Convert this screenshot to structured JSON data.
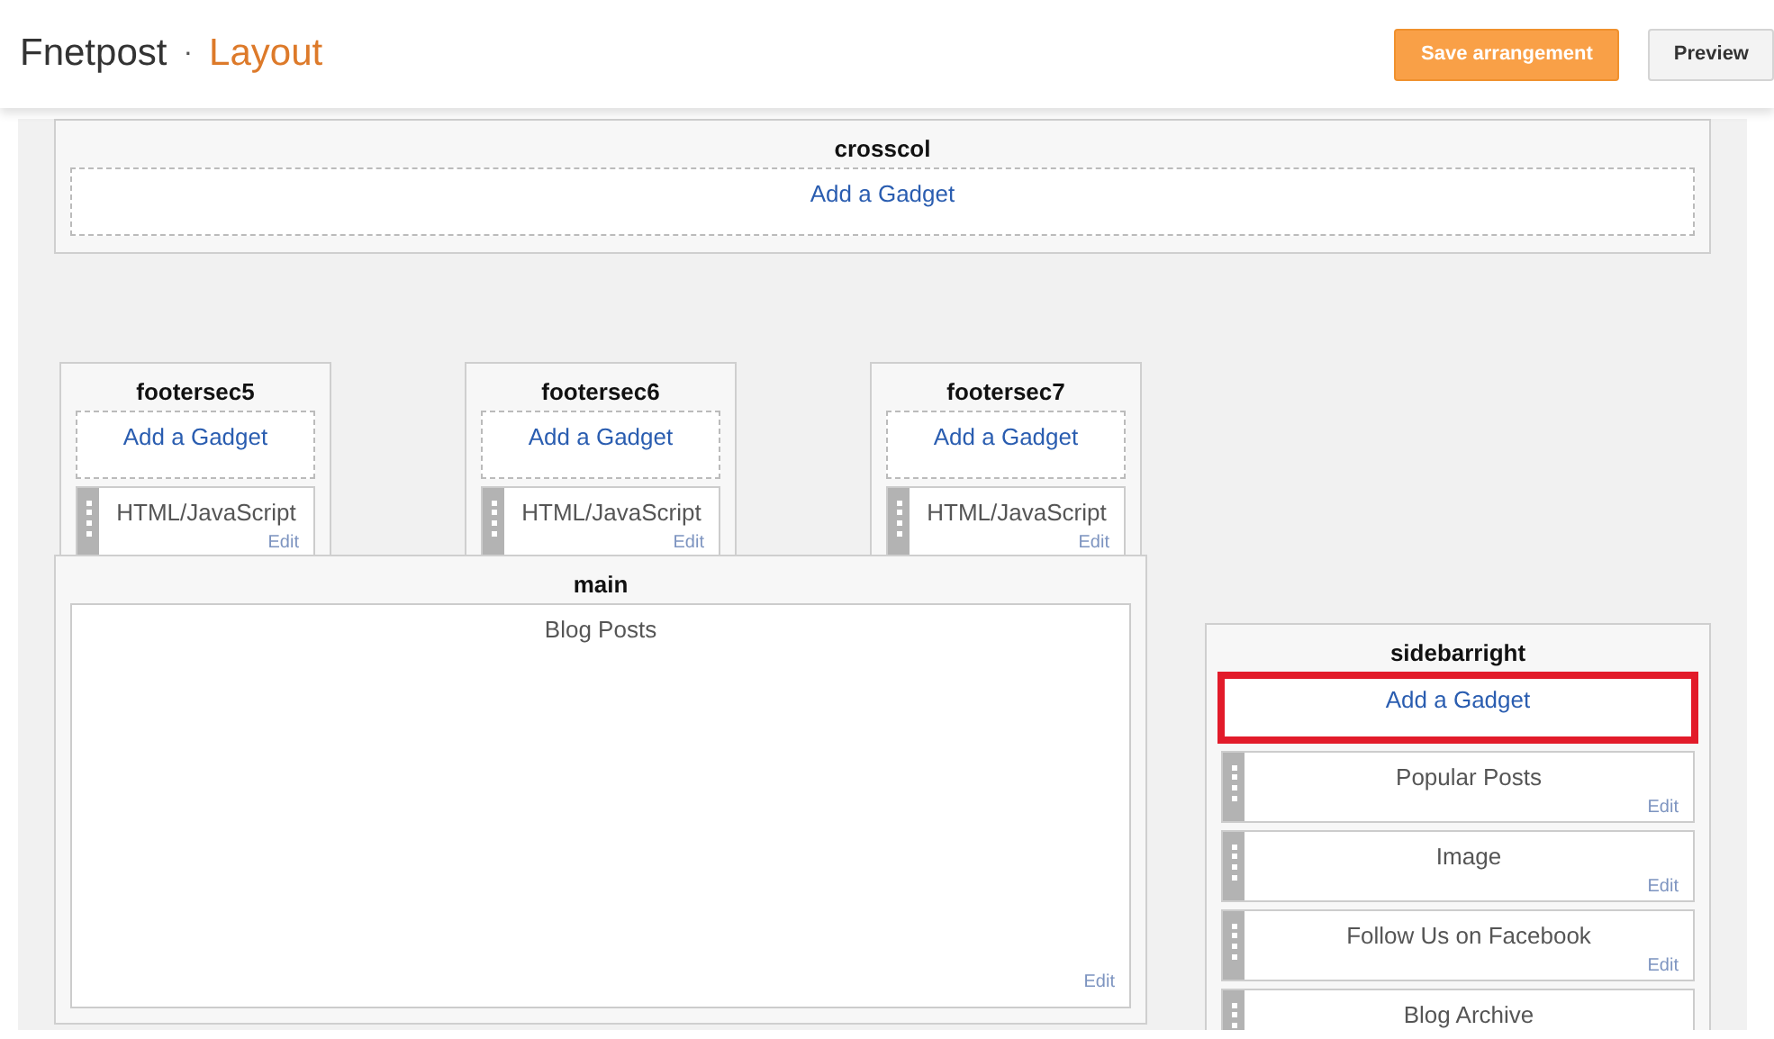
{
  "header": {
    "blog_name": "Fnetpost",
    "separator": "·",
    "page_title": "Layout",
    "buttons": [
      {
        "kind": "primary",
        "label": "Save arrangement"
      },
      {
        "kind": "secondary",
        "label": "Preview"
      }
    ]
  },
  "sections": [
    {
      "name": "crosscol",
      "gadgets": [
        {
          "kind": "add",
          "label": "Add a Gadget",
          "highlighted": false
        }
      ]
    },
    {
      "name": "footersec5",
      "gadgets": [
        {
          "kind": "add",
          "label": "Add a Gadget",
          "highlighted": false
        },
        {
          "kind": "widget",
          "title": "HTML/JavaScript",
          "edit": "Edit",
          "draggable": true
        }
      ]
    },
    {
      "name": "footersec6",
      "gadgets": [
        {
          "kind": "add",
          "label": "Add a Gadget",
          "highlighted": false
        },
        {
          "kind": "widget",
          "title": "HTML/JavaScript",
          "edit": "Edit",
          "draggable": true
        }
      ]
    },
    {
      "name": "footersec7",
      "gadgets": [
        {
          "kind": "add",
          "label": "Add a Gadget",
          "highlighted": false
        },
        {
          "kind": "widget",
          "title": "HTML/JavaScript",
          "edit": "Edit",
          "draggable": true
        }
      ]
    },
    {
      "name": "main",
      "gadgets": [
        {
          "kind": "widget",
          "title": "Blog Posts",
          "edit": "Edit",
          "draggable": false
        }
      ]
    },
    {
      "name": "sidebarright",
      "gadgets": [
        {
          "kind": "add",
          "label": "Add a Gadget",
          "highlighted": true
        },
        {
          "kind": "widget",
          "title": "Popular Posts",
          "edit": "Edit",
          "draggable": true
        },
        {
          "kind": "widget",
          "title": "Image",
          "edit": "Edit",
          "draggable": true
        },
        {
          "kind": "widget",
          "title": "Follow Us on Facebook",
          "edit": "Edit",
          "draggable": true
        },
        {
          "kind": "widget",
          "title": "Blog Archive",
          "draggable": true
        }
      ]
    }
  ]
}
